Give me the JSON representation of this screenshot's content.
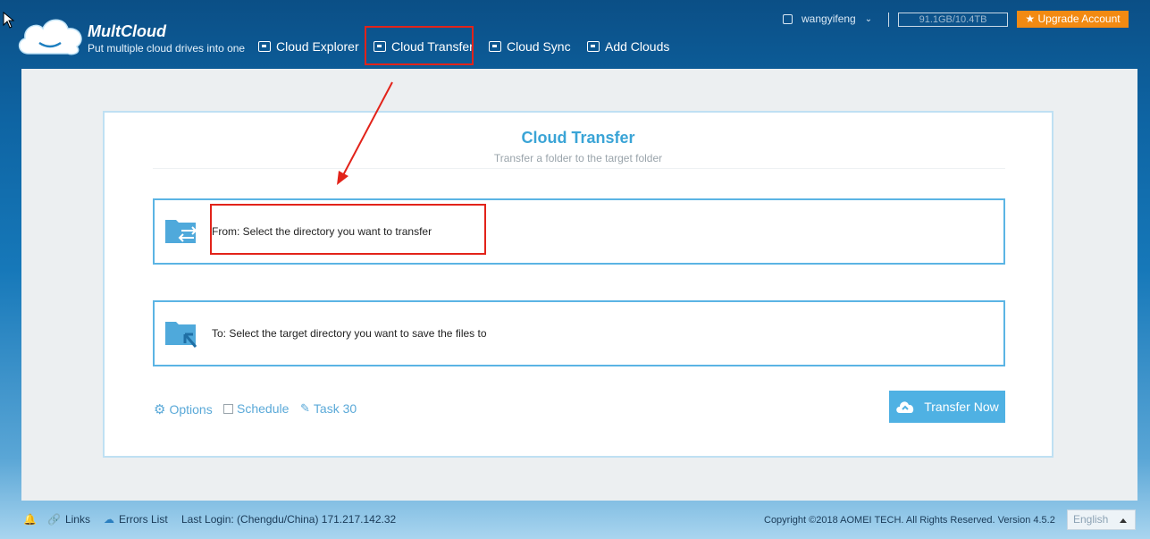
{
  "header": {
    "brand": "MultCloud",
    "tagline": "Put multiple cloud drives into one",
    "nav": [
      {
        "label": "Cloud Explorer"
      },
      {
        "label": "Cloud Transfer"
      },
      {
        "label": "Cloud Sync"
      },
      {
        "label": "Add Clouds"
      }
    ],
    "user": "wangyifeng",
    "storage": "91.1GB/10.4TB",
    "upgrade": "★ Upgrade Account"
  },
  "card": {
    "title": "Cloud Transfer",
    "subtitle": "Transfer a folder to the target folder",
    "from": "From: Select the directory you want to transfer",
    "to": "To: Select the target directory you want to save the files to",
    "options": "Options",
    "schedule": "Schedule",
    "task": "Task 30",
    "transfer_button": "Transfer Now"
  },
  "footer": {
    "links": "Links",
    "errors": "Errors List",
    "last_login": "Last Login: (Chengdu/China) 171.217.142.32",
    "copyright": "Copyright ©2018 AOMEI TECH. All Rights Reserved. Version 4.5.2",
    "language": "English"
  },
  "colors": {
    "accent": "#3aa4d6",
    "highlight": "#e2231a",
    "upgrade": "#f28a12"
  }
}
